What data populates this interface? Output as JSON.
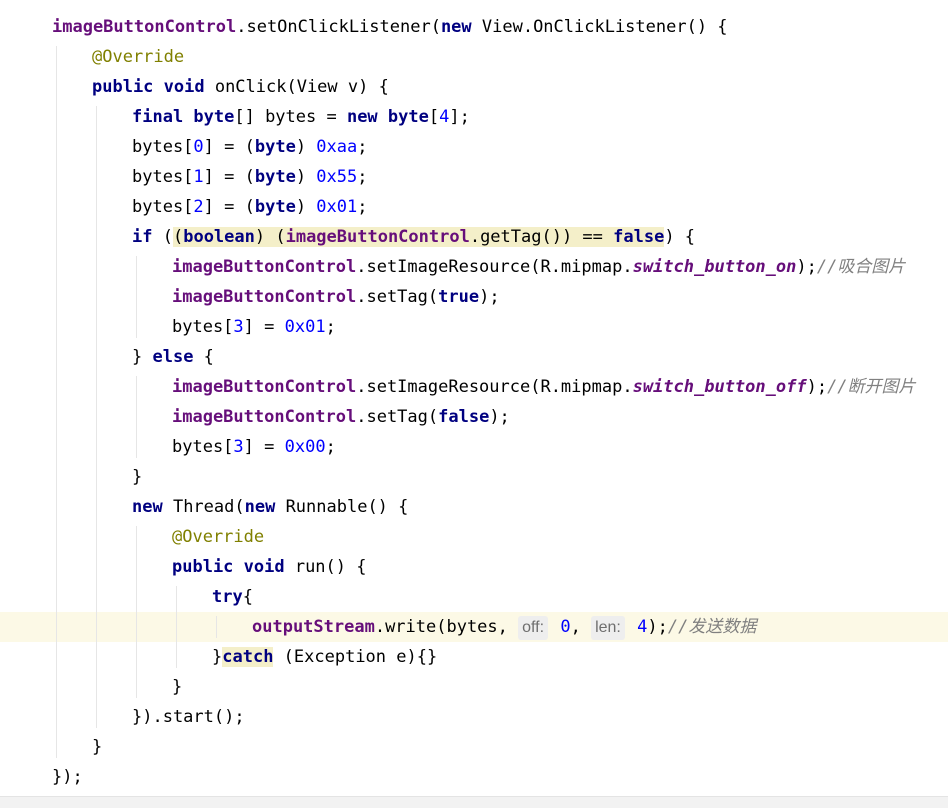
{
  "editor": {
    "lines": [
      {
        "indent": 0,
        "tokens": [
          {
            "t": "imageButtonControl",
            "c": "field"
          },
          {
            "t": ".setOnClickListener("
          },
          {
            "t": "new",
            "c": "kw"
          },
          {
            "t": " View.OnClickListener() {"
          }
        ]
      },
      {
        "indent": 1,
        "tokens": [
          {
            "t": "@Override",
            "c": "ann"
          }
        ]
      },
      {
        "indent": 1,
        "tokens": [
          {
            "t": "public void",
            "c": "kw"
          },
          {
            "t": " onClick(View v) {"
          }
        ]
      },
      {
        "indent": 2,
        "tokens": [
          {
            "t": "final byte",
            "c": "kw"
          },
          {
            "t": "[] bytes = "
          },
          {
            "t": "new byte",
            "c": "kw"
          },
          {
            "t": "["
          },
          {
            "t": "4",
            "c": "num"
          },
          {
            "t": "];"
          }
        ]
      },
      {
        "indent": 2,
        "tokens": [
          {
            "t": "bytes["
          },
          {
            "t": "0",
            "c": "num"
          },
          {
            "t": "] = ("
          },
          {
            "t": "byte",
            "c": "kw"
          },
          {
            "t": ") "
          },
          {
            "t": "0xaa",
            "c": "num"
          },
          {
            "t": ";"
          }
        ]
      },
      {
        "indent": 2,
        "tokens": [
          {
            "t": "bytes["
          },
          {
            "t": "1",
            "c": "num"
          },
          {
            "t": "] = ("
          },
          {
            "t": "byte",
            "c": "kw"
          },
          {
            "t": ") "
          },
          {
            "t": "0x55",
            "c": "num"
          },
          {
            "t": ";"
          }
        ]
      },
      {
        "indent": 2,
        "tokens": [
          {
            "t": "bytes["
          },
          {
            "t": "2",
            "c": "num"
          },
          {
            "t": "] = ("
          },
          {
            "t": "byte",
            "c": "kw"
          },
          {
            "t": ") "
          },
          {
            "t": "0x01",
            "c": "num"
          },
          {
            "t": ";"
          }
        ]
      },
      {
        "indent": 2,
        "tokens": [
          {
            "t": "if",
            "c": "kw"
          },
          {
            "t": " ("
          },
          {
            "t": "(",
            "c": "hl"
          },
          {
            "t": "boolean",
            "c": "kw hl"
          },
          {
            "t": ") (",
            "c": "hl"
          },
          {
            "t": "imageButtonControl",
            "c": "field hl"
          },
          {
            "t": ".getTag()) == ",
            "c": "hl"
          },
          {
            "t": "false",
            "c": "kw hl"
          },
          {
            "t": ") {"
          }
        ]
      },
      {
        "indent": 3,
        "tokens": [
          {
            "t": "imageButtonControl",
            "c": "field"
          },
          {
            "t": ".setImageResource(R.mipmap."
          },
          {
            "t": "switch_button_on",
            "c": "ital"
          },
          {
            "t": ");"
          },
          {
            "t": "//吸合图片",
            "c": "cm"
          }
        ]
      },
      {
        "indent": 3,
        "tokens": [
          {
            "t": "imageButtonControl",
            "c": "field"
          },
          {
            "t": ".setTag("
          },
          {
            "t": "true",
            "c": "kw"
          },
          {
            "t": ");"
          }
        ]
      },
      {
        "indent": 3,
        "tokens": [
          {
            "t": "bytes["
          },
          {
            "t": "3",
            "c": "num"
          },
          {
            "t": "] = "
          },
          {
            "t": "0x01",
            "c": "num"
          },
          {
            "t": ";"
          }
        ]
      },
      {
        "indent": 2,
        "tokens": [
          {
            "t": "} "
          },
          {
            "t": "else",
            "c": "kw"
          },
          {
            "t": " {"
          }
        ]
      },
      {
        "indent": 3,
        "tokens": [
          {
            "t": "imageButtonControl",
            "c": "field"
          },
          {
            "t": ".setImageResource(R.mipmap."
          },
          {
            "t": "switch_button_off",
            "c": "ital"
          },
          {
            "t": ");"
          },
          {
            "t": "//断开图片",
            "c": "cm"
          }
        ]
      },
      {
        "indent": 3,
        "tokens": [
          {
            "t": "imageButtonControl",
            "c": "field"
          },
          {
            "t": ".setTag("
          },
          {
            "t": "false",
            "c": "kw"
          },
          {
            "t": ");"
          }
        ]
      },
      {
        "indent": 3,
        "tokens": [
          {
            "t": "bytes["
          },
          {
            "t": "3",
            "c": "num"
          },
          {
            "t": "] = "
          },
          {
            "t": "0x00",
            "c": "num"
          },
          {
            "t": ";"
          }
        ]
      },
      {
        "indent": 2,
        "tokens": [
          {
            "t": "}"
          }
        ]
      },
      {
        "indent": 2,
        "tokens": [
          {
            "t": "new",
            "c": "kw"
          },
          {
            "t": " Thread("
          },
          {
            "t": "new",
            "c": "kw"
          },
          {
            "t": " Runnable() {"
          }
        ]
      },
      {
        "indent": 3,
        "tokens": [
          {
            "t": "@Override",
            "c": "ann"
          }
        ]
      },
      {
        "indent": 3,
        "tokens": [
          {
            "t": "public void",
            "c": "kw"
          },
          {
            "t": " run() {"
          }
        ]
      },
      {
        "indent": 4,
        "tokens": [
          {
            "t": "try",
            "c": "kw"
          },
          {
            "t": "{"
          }
        ]
      },
      {
        "indent": 5,
        "current": true,
        "tokens": [
          {
            "t": "outputStream",
            "c": "field"
          },
          {
            "t": ".write(bytes, "
          },
          {
            "t": "off:",
            "c": "hint"
          },
          {
            "t": " "
          },
          {
            "t": "0",
            "c": "num"
          },
          {
            "t": ", "
          },
          {
            "t": "len:",
            "c": "hint"
          },
          {
            "t": " "
          },
          {
            "t": "4",
            "c": "num"
          },
          {
            "t": ");"
          },
          {
            "t": "//发送数据",
            "c": "cm"
          }
        ]
      },
      {
        "indent": 4,
        "tokens": [
          {
            "t": "}"
          },
          {
            "t": "catch",
            "c": "kw catchhl"
          },
          {
            "t": " (Exception e){}"
          }
        ]
      },
      {
        "indent": 3,
        "tokens": [
          {
            "t": "}"
          }
        ]
      },
      {
        "indent": 2,
        "tokens": [
          {
            "t": "}).start();"
          }
        ]
      },
      {
        "indent": 1,
        "tokens": [
          {
            "t": "}"
          }
        ]
      },
      {
        "indent": 0,
        "tokens": [
          {
            "t": "});"
          }
        ]
      }
    ]
  },
  "colors": {
    "keyword": "#000080",
    "field": "#660e7a",
    "number": "#0000ff",
    "annotation": "#808000",
    "comment": "#808080",
    "current_line": "#fcf9e6",
    "highlight": "#f4efc9"
  }
}
